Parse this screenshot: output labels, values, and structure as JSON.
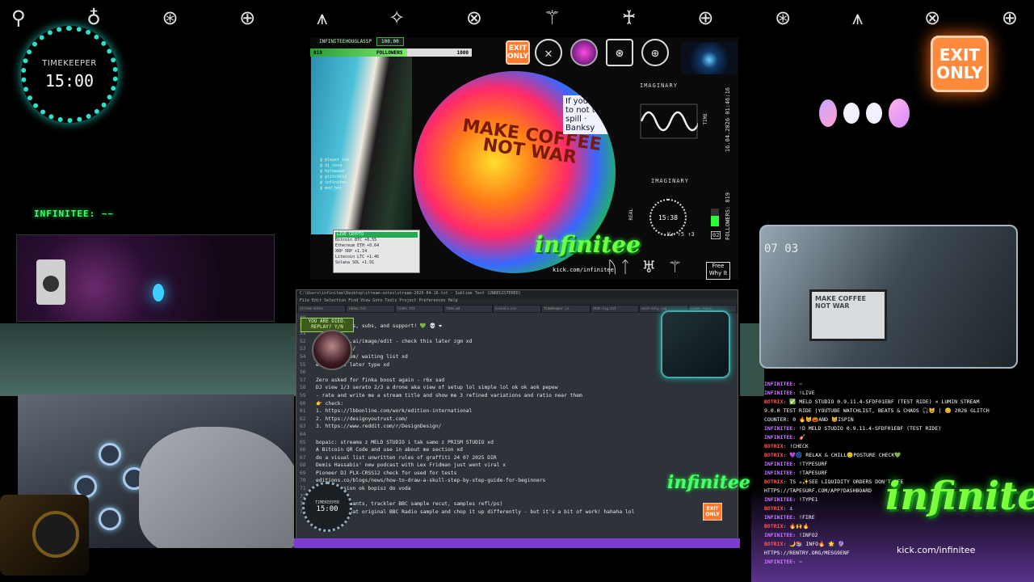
{
  "header": {
    "glyphs": [
      "⚲",
      "♁",
      "⊛",
      "⊕",
      "⩚",
      "✧",
      "⊗",
      "⚚",
      "♰",
      "⊕",
      "⊛",
      "⩚",
      "⊗",
      "⊕"
    ]
  },
  "timekeeper": {
    "label": "TIMEKEEPER",
    "time": "15:00"
  },
  "exit_sign": {
    "line1": "EXIT",
    "line2": "ONLY"
  },
  "left": {
    "tag": "INFINITEE: ~~"
  },
  "scene": {
    "channel": "INFINITEEHOUGLASSP",
    "score": "100.00",
    "followers_label": "FOLLOWERS",
    "followers_left": "819",
    "followers_right": "1000",
    "art_text": "MAKE COFFEE NOT WAR",
    "quote": "If you learn to not to spill · Banksy",
    "logo": "infinitee",
    "logo_sub": "kick.com/infinitee",
    "mini_list": [
      "@ player_one",
      "@ dj_nova",
      "@ bytewave",
      "@ glitchkid",
      "@ infinitee",
      "@ mod_bot"
    ],
    "crypto": {
      "header": "LIVE CRYPTO",
      "rows": [
        "Bitcoin  BTC  +0.55",
        "Ethereum ETH  +0.64",
        "XRP  XRP  +1.14",
        "Litecoin LTC  +1.46",
        "Solana  SOL  +1.91"
      ]
    },
    "exit_small": {
      "line1": "EXIT",
      "line2": "ONLY"
    },
    "imaginary_1": "IMAGINARY",
    "time_label": "TIME",
    "datestamp": "16.04.2026 01:46:16",
    "imaginary_2": "IMAGINARY",
    "real_label": "REAL",
    "mini_clock": "15:38",
    "followers_vertical": "FOLLOWERS: 819",
    "meter_num": "02",
    "stats": "K↑  ↑5 ↑3",
    "free_box": "Free Why It",
    "runes": "ᚢᛏ ♅ ⚚"
  },
  "editor": {
    "title": "C:\\Users\\infinitee\\Desktop\\stream-notes\\stream-2026-04-16.txt - Sublime Text (UNREGISTERED)",
    "menu": "File  Edit  Selection  Find  View  Goto  Tools  Project  Preferences  Help",
    "tabs": [
      "stream-notes",
      "ideas.txt",
      "links.txt",
      "todo.md",
      "visuals.css",
      "timekeeper.js",
      "chat-log.txt",
      "exit-only.svg",
      "scene-rules"
    ],
    "died_line1": "YOU ARE DIED.",
    "died_line2": "REPLAY? Y/N",
    "lines": [
      {
        "n": "49",
        "t": ""
      },
      {
        "n": "50",
        "t": "                        for the hosts, subs, and support! 💚 💀 ❤"
      },
      {
        "n": "51",
        "t": ""
      },
      {
        "n": "52",
        "t": "                        yground.bfl.ai/image/edit - check this later zgm xd"
      },
      {
        "n": "53",
        "t": "                        .clipy.space/"
      },
      {
        "n": "54",
        "t": "                        erastudio.com/ waiting list xd"
      },
      {
        "n": "55",
        "t": "                        e.app/ inv later type xd"
      },
      {
        "n": "56",
        "t": ""
      },
      {
        "n": "57",
        "t": "Zero asked for finka boost again - r6x sad"
      },
      {
        "n": "58",
        "t": "DJ view 1/3 serato 2/3 a drone aka view of setup lol simple lol ok ok aok pepew"
      },
      {
        "n": "59",
        "t": "- rate and write me a stream title and show me 3 refined variations and ratio near them"
      },
      {
        "n": "60",
        "t": "  👉 check:"
      },
      {
        "n": "61",
        "t": "1. https://lbbonline.com/work/edition-international"
      },
      {
        "n": "62",
        "t": "2. https://designyoutrust.com/"
      },
      {
        "n": "63",
        "t": "3. https://www.reddit.com/r/DesignDesign/"
      },
      {
        "n": "64",
        "t": ""
      },
      {
        "n": "65",
        "t": "bopaic: streama z MELD STUDIO i tak samo z PRISM STUDIO xd"
      },
      {
        "n": "66",
        "t": "A Bitcoin QR Code and use in about me section xd"
      },
      {
        "n": "67",
        "t": "do a visual list unwritten rules of graffiti 24 07 2025 DIR"
      },
      {
        "n": "68",
        "t": "Demis Hassabis' new podcast with Lex Fridman just went viral x"
      },
      {
        "n": "69",
        "t": "Pioneer DJ PLX-CRSS12 check for used for tests"
      },
      {
        "n": "70",
        "t": "                        editions.co/blogs/news/how-to-draw-a-skull-step-by-step-guide-for-beginners"
      },
      {
        "n": "71",
        "t": "                        ients session ok bopisz do voda"
      },
      {
        "n": "72",
        "t": ""
      },
      {
        "n": "73",
        "t": "                        making of chants, trackler BBC sample recut, samples refl/ps)"
      },
      {
        "n": "74",
        "t": "                        ould find that original BBC Radio sample and chop it up differently - but it's a bit of work! hahaha lol"
      }
    ],
    "overlay_clock_label": "TIMEKEEPER",
    "overlay_clock_time": "15:00",
    "logo": "infinitee",
    "exit": "EXIT ONLY"
  },
  "right_cam": {
    "counter": "07 03",
    "monitor_text": "MAKE COFFEE NOT WAR"
  },
  "chat": [
    {
      "u": "INFINITEE:",
      "m": " ~"
    },
    {
      "u": "INFINITEE:",
      "m": " !LIVE"
    },
    {
      "u": "BOTRIX:",
      "m": " ✅ MELD STUDIO 0.9.11.4-SFDF01EBF (TEST RIDE) × LUMIN STREAM",
      "g": true
    },
    {
      "u": "",
      "m": "9.0.0 TEST RIDE |YOUTUBE WATCHLIST, BEATS & CHAOS 🎧😺 | 😊 2026 GLITCH"
    },
    {
      "u": "",
      "m": "COUNTER: 0 🔥😸🎃AND 😸ISPIN"
    },
    {
      "u": "INFINITEE:",
      "m": " !D MELD STUDIO 0.9.11.4-SFDF01EBF (TEST RIDE)"
    },
    {
      "u": "INFINITEE:",
      "m": " 🎸"
    },
    {
      "u": "BOTRIX:",
      "m": " !CHECK",
      "g": true
    },
    {
      "u": "BOTRIX:",
      "m": " 💜🌀 RELAX & CHILL😊POSTURE CHECK💚",
      "g": true
    },
    {
      "u": "INFINITEE:",
      "m": " !TYPESURF"
    },
    {
      "u": "INFINITEE:",
      "m": " !TAPESURF"
    },
    {
      "u": "BOTRIX:",
      "m": " TS ☕✨SEE LIQUIDITY ORDERS DON'T SEE",
      "g": true
    },
    {
      "u": "",
      "m": "HTTPS://TAPESURF.COM/APP?DASHBOARD"
    },
    {
      "u": "INFINITEE:",
      "m": " !TYPE1"
    },
    {
      "u": "BOTRIX:",
      "m": " ⚓",
      "g": true
    },
    {
      "u": "INFINITEE:",
      "m": " !FIRE"
    },
    {
      "u": "BOTRIX:",
      "m": " 🔥🙌🔥",
      "g": true
    },
    {
      "u": "INFINITEE:",
      "m": " !INFO2"
    },
    {
      "u": "BOTRIX:",
      "m": " 🌙📚 INFO🔥 🌟 🔮",
      "g": true
    },
    {
      "u": "",
      "m": "HTTPS://RENTRY.ORG/MESG9ENF"
    },
    {
      "u": "INFINITEE:",
      "m": " ~"
    }
  ],
  "brand": {
    "logo": "infinitee",
    "url": "kick.com/infinitee"
  },
  "colors": {
    "accent_green": "#7cff3c",
    "accent_orange": "#ff8a3c",
    "accent_purple": "#a45cff",
    "teal": "#2de0c8"
  }
}
